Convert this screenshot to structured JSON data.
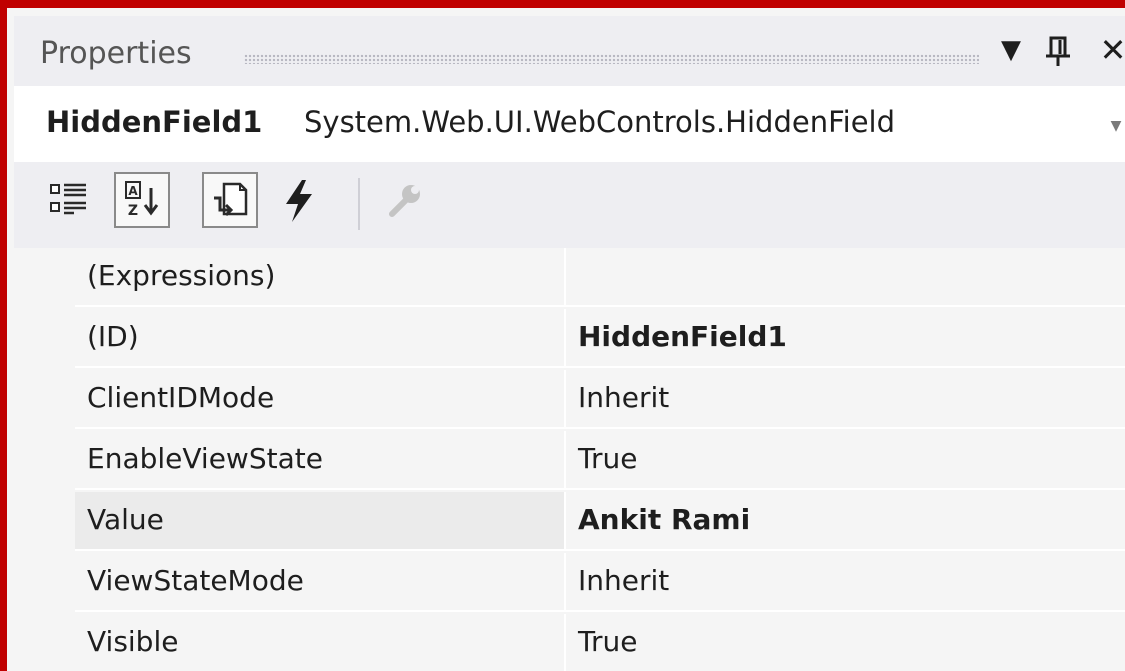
{
  "window": {
    "title": "Properties",
    "dropdown_icon": "triangle-down-icon",
    "pin_icon": "pin-icon",
    "close_icon": "close-icon"
  },
  "object_selector": {
    "name": "HiddenField1",
    "type": "System.Web.UI.WebControls.HiddenField"
  },
  "toolbar": {
    "items": [
      {
        "name": "categorized",
        "icon": "categorized-icon",
        "checked": false
      },
      {
        "name": "alphabetical",
        "icon": "sort-az-icon",
        "checked": true
      },
      {
        "name": "properties",
        "icon": "properties-icon",
        "checked": true
      },
      {
        "name": "events",
        "icon": "lightning-icon",
        "checked": false
      },
      {
        "name": "property-pages",
        "icon": "wrench-icon",
        "checked": false,
        "disabled": true
      }
    ]
  },
  "properties": [
    {
      "name": "(Expressions)",
      "value": "",
      "bold": false
    },
    {
      "name": "(ID)",
      "value": "HiddenField1",
      "bold": true
    },
    {
      "name": "ClientIDMode",
      "value": "Inherit",
      "bold": false
    },
    {
      "name": "EnableViewState",
      "value": "True",
      "bold": false
    },
    {
      "name": "Value",
      "value": "Ankit Rami",
      "bold": true
    },
    {
      "name": "ViewStateMode",
      "value": "Inherit",
      "bold": false
    },
    {
      "name": "Visible",
      "value": "True",
      "bold": false
    }
  ],
  "colors": {
    "frame_border": "#c00000",
    "panel_background": "#eeeef2",
    "grid_background": "#f5f5f5",
    "text": "#1e1e1e"
  }
}
